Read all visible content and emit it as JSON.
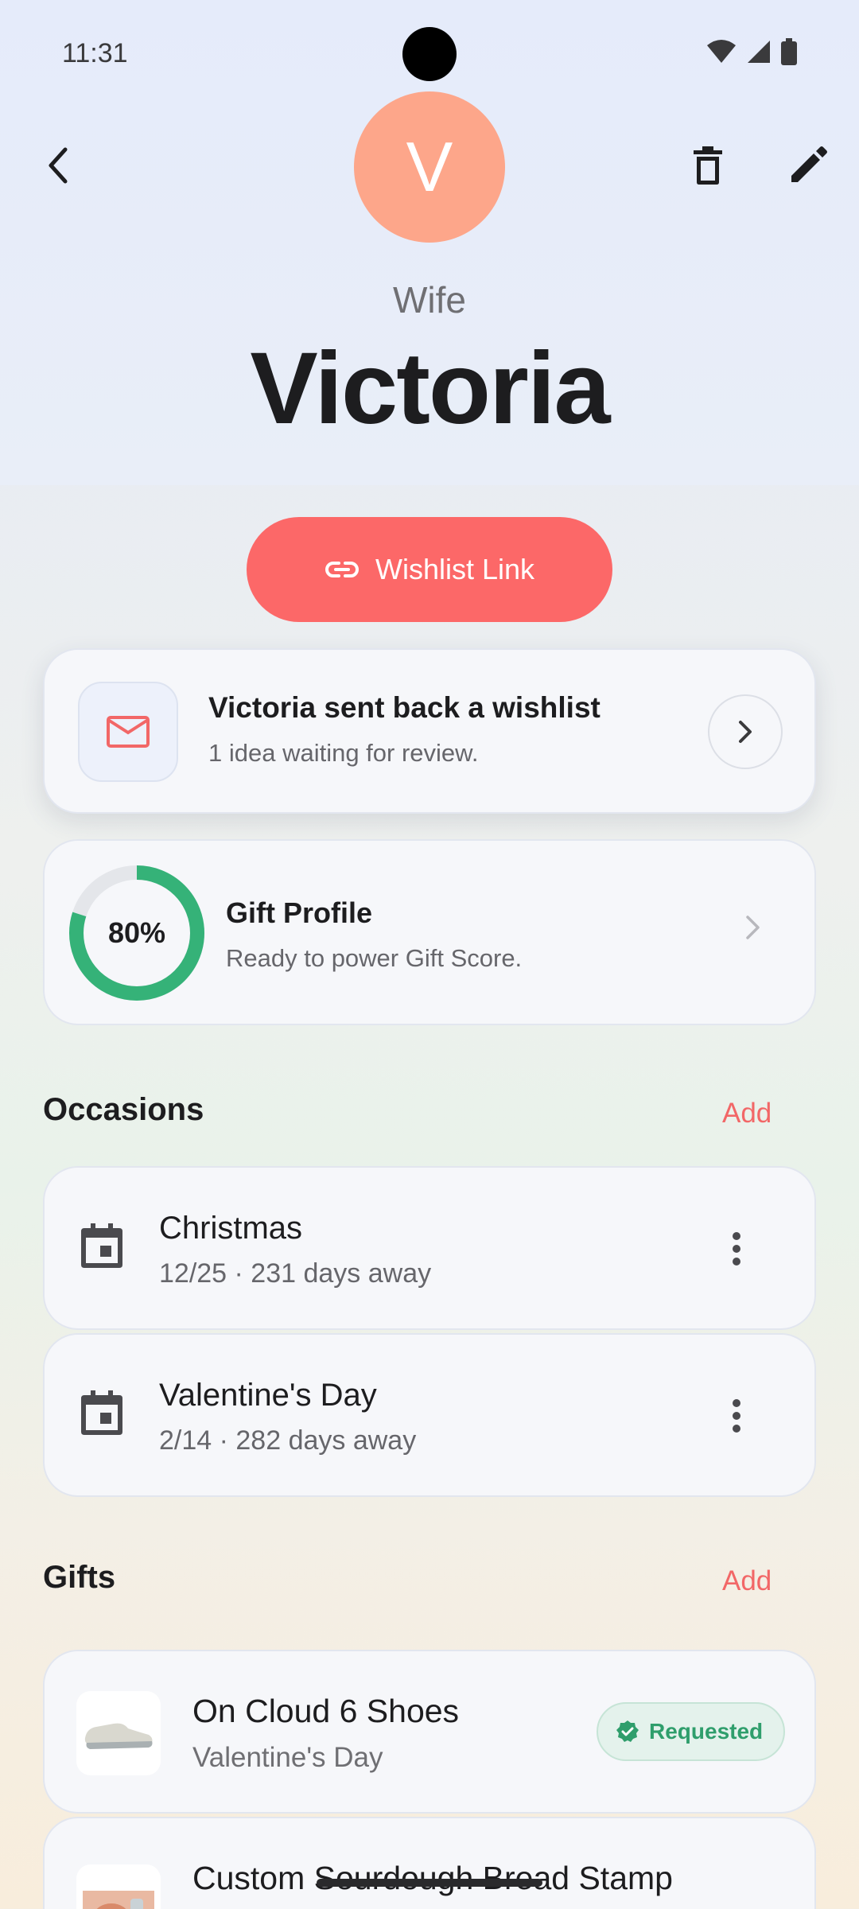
{
  "status": {
    "time": "11:31"
  },
  "colors": {
    "accent": "#fc6868",
    "avatar": "#fda68a",
    "success": "#2f9e6c"
  },
  "contact": {
    "initial": "V",
    "relation": "Wife",
    "name": "Victoria"
  },
  "wishlist_button": {
    "label": "Wishlist Link"
  },
  "wishlist_card": {
    "title": "Victoria sent back a wishlist",
    "subtitle": "1 idea waiting for review."
  },
  "gift_profile": {
    "percent_label": "80%",
    "completion": 0.8,
    "title": "Gift Profile",
    "subtitle": "Ready to power Gift Score."
  },
  "occasions": {
    "title": "Occasions",
    "add_label": "Add",
    "items": [
      {
        "title": "Christmas",
        "subtitle": "12/25 · 231 days away"
      },
      {
        "title": "Valentine's Day",
        "subtitle": "2/14 · 282 days away"
      }
    ]
  },
  "gifts": {
    "title": "Gifts",
    "add_label": "Add",
    "items": [
      {
        "title": "On Cloud 6 Shoes",
        "subtitle": "Valentine's Day",
        "badge": "Requested"
      },
      {
        "title": "Custom Sourdough Bread Stamp"
      }
    ]
  }
}
